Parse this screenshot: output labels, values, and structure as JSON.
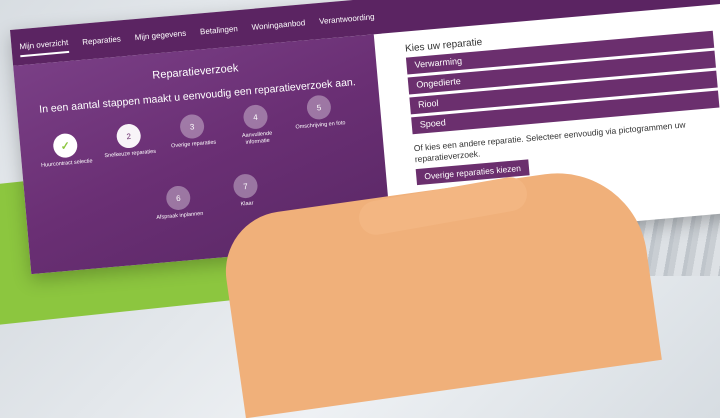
{
  "nav": {
    "items": [
      {
        "label": "Mijn overzicht",
        "active": true
      },
      {
        "label": "Reparaties"
      },
      {
        "label": "Mijn gegevens"
      },
      {
        "label": "Betalingen"
      },
      {
        "label": "Woningaanbod"
      },
      {
        "label": "Verantwoording"
      }
    ]
  },
  "wizard": {
    "title": "Reparatieverzoek",
    "subtitle": "In een aantal stappen maakt u eenvoudig een reparatieverzoek aan.",
    "steps": [
      {
        "number": "✓",
        "label": "Huurcontract selectie"
      },
      {
        "number": "2",
        "label": "Snelkeuze reparaties"
      },
      {
        "number": "3",
        "label": "Overige reparaties"
      },
      {
        "number": "4",
        "label": "Aanvullende informatie"
      },
      {
        "number": "5",
        "label": "Omschrijving en foto"
      },
      {
        "number": "6",
        "label": "Afspraak inplannen"
      },
      {
        "number": "7",
        "label": "Klaar"
      }
    ]
  },
  "repairs": {
    "heading": "Kies uw reparatie",
    "options": [
      "Verwarming",
      "Ongedierte",
      "Riool",
      "Spoed"
    ],
    "hint": "Of kies een andere reparatie. Selecteer eenvoudig via pictogrammen uw reparatieverzoek.",
    "choose_button": "Overige reparaties kiezen"
  },
  "colors": {
    "brand_purple": "#6b2f6e",
    "accent_green": "#8cc63f"
  }
}
